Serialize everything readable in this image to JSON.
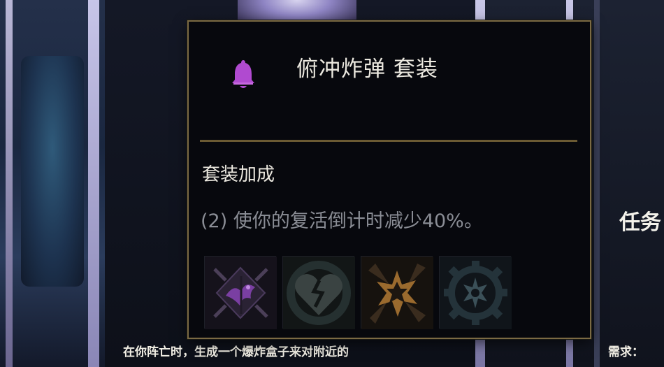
{
  "tooltip": {
    "set_name": "俯冲炸弹 套装",
    "set_icon": "bell-icon",
    "accent_color": "#b04ad0",
    "bonus_heading": "套装加成",
    "bonus_desc": "(2) 使你的复活倒计时减少40%。",
    "items": [
      {
        "icon": "purple-bird-emblem-icon"
      },
      {
        "icon": "broken-heart-icon"
      },
      {
        "icon": "orange-burst-icon"
      },
      {
        "icon": "gear-burst-icon"
      }
    ]
  },
  "background": {
    "right_title": "任务",
    "bottom_line": "在你阵亡时，生成一个爆炸盒子来对附近的",
    "requirement_label": "需求："
  }
}
